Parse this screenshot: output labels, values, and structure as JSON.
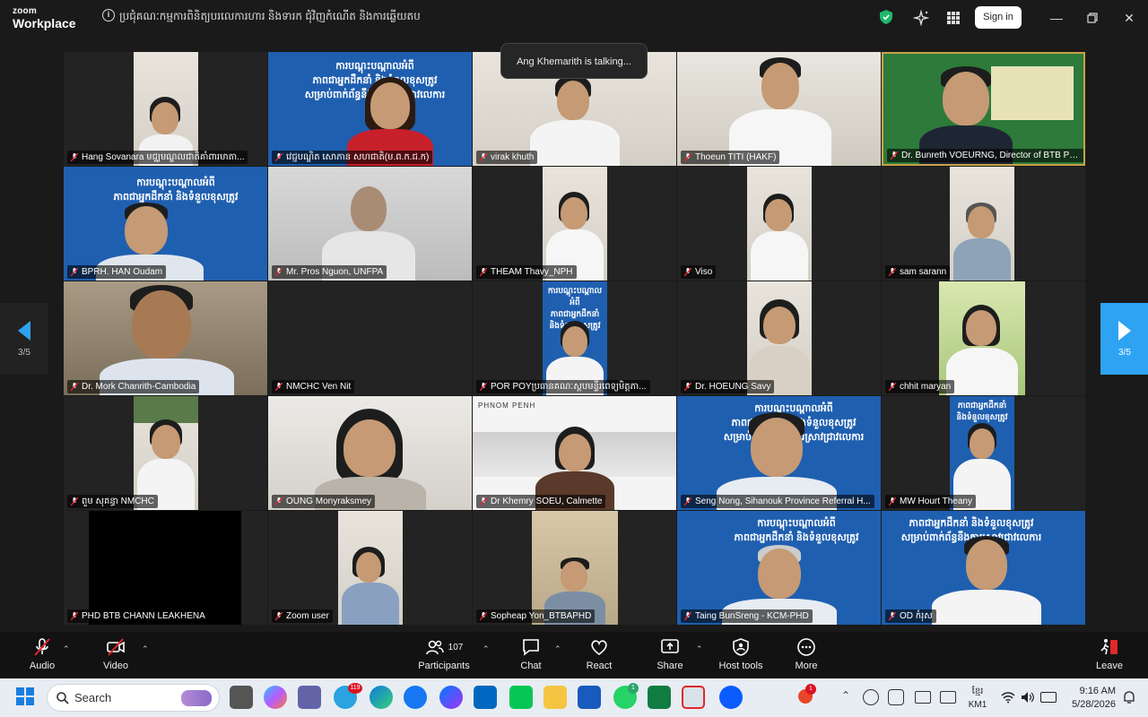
{
  "app": {
    "brand_line1": "zoom",
    "brand_line2": "Workplace",
    "meeting_title": "ប្រជុំគណៈកម្មការពិនិត្យបរលេការហារ និងទារក ជុំវិញកំណើត និងការឆ្លើយតប",
    "sign_in_label": "Sign in"
  },
  "talking_indicator": "Ang Khemarith is talking...",
  "page_indicator": {
    "left": "3/5",
    "right": "3/5"
  },
  "participants": [
    {
      "name": "Hang Sovanara មជ្ឈមណ្ឌលជាតិគាំពារមាតា..."
    },
    {
      "name": "វេជ្ជបណ្ឌិត សោភាន សហជាតិ(ម.ព.ក.ជ.ក)"
    },
    {
      "name": "virak khuth"
    },
    {
      "name": "Thoeun TITI (HAKF)"
    },
    {
      "name": "Dr. Bunreth VOEURNG, Director of BTB PH..."
    },
    {
      "name": "BPRH. HAN Oudam"
    },
    {
      "name": "Mr. Pros Nguon, UNFPA"
    },
    {
      "name": "THEAM Thavy_NPH"
    },
    {
      "name": "Viso"
    },
    {
      "name": "sam sarann"
    },
    {
      "name": "Dr. Mork Chanrith-Cambodia"
    },
    {
      "name": "NMCHC Ven Nit"
    },
    {
      "name": "POR POYប្រធានគណៈស្តបមន្ទីរពេទ្យមិត្តភា..."
    },
    {
      "name": "Dr. HOEUNG Savy"
    },
    {
      "name": "chhit maryan"
    },
    {
      "name": "ពួម សុគន្ធា NMCHC"
    },
    {
      "name": "OUNG Monyraksmey"
    },
    {
      "name": "Dr Khemry SOEU, Calmette"
    },
    {
      "name": "Seng Nong, Sihanouk Province Referral H..."
    },
    {
      "name": "MW Hourt Theany"
    },
    {
      "name": "PHD BTB CHANN LEAKHENA"
    },
    {
      "name": "Zoom user"
    },
    {
      "name": "Sopheap Yon_BTBAPHD"
    },
    {
      "name": "Taing BunSreng - KCM-PHD"
    },
    {
      "name": "OD កំរុស"
    }
  ],
  "banner": {
    "line1": "ការបណ្តុះបណ្តាលអំពី",
    "line2": "ភាពជាអ្នកដឹកនាំ និងទំនួលខុសត្រូវ",
    "line3": "សម្រាប់ពាក់ព័ន្ធនឹងការស្រាវជ្រាវលេការ",
    "line4": "ឆ្នាំ ២០២៦",
    "phnom_penh": "PHNOM PENH"
  },
  "toolbar": {
    "audio": "Audio",
    "video": "Video",
    "participants": "Participants",
    "participants_count": "107",
    "chat": "Chat",
    "react": "React",
    "share": "Share",
    "host_tools": "Host tools",
    "more": "More",
    "leave": "Leave"
  },
  "taskbar": {
    "search_label": "Search",
    "lang_line1": "ខ្មែរ",
    "lang_line2": "KM1",
    "time": "9:16 AM",
    "date": "5/28/2026",
    "telegram_badge": "119",
    "whatsapp_badge": "1",
    "notif_badge": "1"
  },
  "colors": {
    "zoom_blue": "#2ea3f2",
    "banner_blue": "#1f5fb0",
    "leave_red": "#e02828"
  }
}
